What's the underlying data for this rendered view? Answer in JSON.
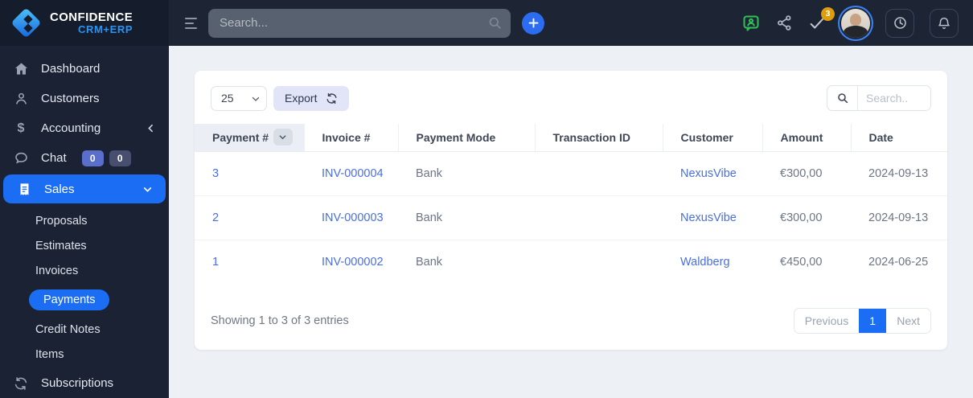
{
  "brand": {
    "line1": "CONFIDENCE",
    "line2": "CRM+ERP"
  },
  "colors": {
    "accent_blue": "#1b6ef3",
    "link_blue": "#4a6fe0",
    "sidebar_bg": "#1a2234",
    "topbar_bg": "#1d2535",
    "badge_amber": "#dd9d0c",
    "message_green": "#2ec158",
    "export_lavender": "#e2e5f8"
  },
  "topbar": {
    "search_placeholder": "Search...",
    "check_badge": "3"
  },
  "sidebar": {
    "items": [
      {
        "label": "Dashboard"
      },
      {
        "label": "Customers"
      },
      {
        "label": "Accounting"
      },
      {
        "label": "Chat"
      },
      {
        "label": "Sales"
      },
      {
        "label": "Subscriptions"
      }
    ],
    "chat_badges": [
      "0",
      "0"
    ],
    "sales_children": [
      {
        "label": "Proposals",
        "active": false
      },
      {
        "label": "Estimates",
        "active": false
      },
      {
        "label": "Invoices",
        "active": false
      },
      {
        "label": "Payments",
        "active": true
      },
      {
        "label": "Credit Notes",
        "active": false
      },
      {
        "label": "Items",
        "active": false
      }
    ]
  },
  "toolbar": {
    "page_size": "25",
    "export_label": "Export",
    "search_placeholder": "Search.."
  },
  "table": {
    "headers": [
      "Payment #",
      "Invoice #",
      "Payment Mode",
      "Transaction ID",
      "Customer",
      "Amount",
      "Date"
    ],
    "rows": [
      {
        "payment": "3",
        "invoice": "INV-000004",
        "mode": "Bank",
        "transaction": "",
        "customer": "NexusVibe",
        "amount": "€300,00",
        "date": "2024-09-13"
      },
      {
        "payment": "2",
        "invoice": "INV-000003",
        "mode": "Bank",
        "transaction": "",
        "customer": "NexusVibe",
        "amount": "€300,00",
        "date": "2024-09-13"
      },
      {
        "payment": "1",
        "invoice": "INV-000002",
        "mode": "Bank",
        "transaction": "",
        "customer": "Waldberg",
        "amount": "€450,00",
        "date": "2024-06-25"
      }
    ]
  },
  "footer": {
    "showing": "Showing 1 to 3 of 3 entries",
    "previous": "Previous",
    "page": "1",
    "next": "Next"
  }
}
